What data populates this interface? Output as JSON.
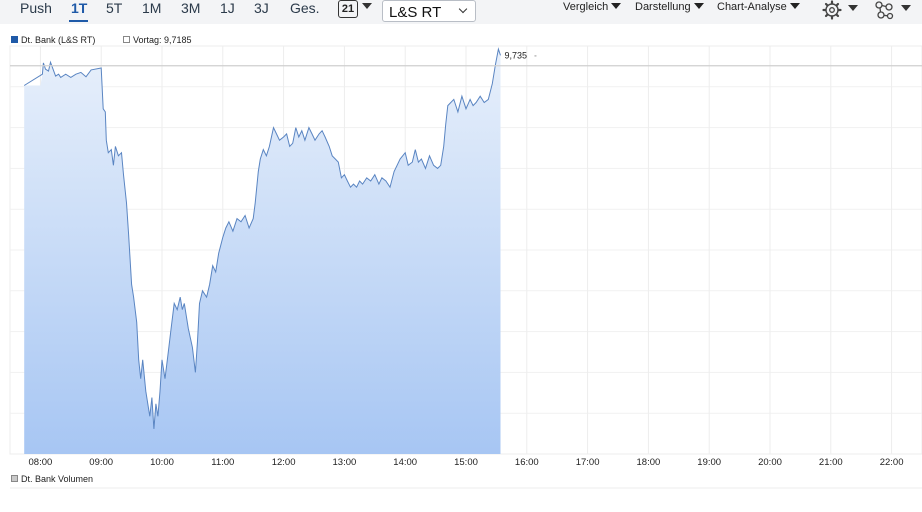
{
  "toolbar": {
    "range_tabs": [
      "Push",
      "1T",
      "5T",
      "1M",
      "3M",
      "1J",
      "3J",
      "Ges."
    ],
    "active_tab": "1T",
    "calendar_label": "21",
    "exchange": "L&S RT",
    "menus": [
      "Vergleich",
      "Darstellung",
      "Chart-Analyse"
    ],
    "icons": [
      "settings-gear-icon",
      "indicators-network-icon"
    ]
  },
  "legend": {
    "series_label": "Dt. Bank (L&S RT)",
    "prev_close_label": "Vortag: 9,7185",
    "volume_label": "Dt. Bank Volumen"
  },
  "colors": {
    "line": "#5a85c2",
    "fill_top": "#e8f0fb",
    "fill_bottom": "#a7c6f3",
    "active": "#1f5aa8",
    "swatch": "#1f5aa8"
  },
  "chart_data": {
    "type": "area",
    "title": "",
    "xlabel": "",
    "ylabel": "",
    "x_ticks": [
      "08:00",
      "09:00",
      "10:00",
      "11:00",
      "12:00",
      "13:00",
      "14:00",
      "15:00",
      "16:00",
      "17:00",
      "18:00",
      "19:00",
      "20:00",
      "21:00",
      "22:00"
    ],
    "x_range": [
      "07:30",
      "22:30"
    ],
    "ylim": [
      9.1,
      9.75
    ],
    "previous_close": 9.7185,
    "last_value_label": "9,735",
    "grid": true,
    "series": [
      {
        "name": "Dt. Bank (L&S RT)",
        "points": [
          [
            "07:30",
            9.687
          ],
          [
            "08:00",
            9.687
          ],
          [
            "08:02",
            9.705
          ],
          [
            "08:03",
            9.723
          ],
          [
            "08:05",
            9.713
          ],
          [
            "08:08",
            9.71
          ],
          [
            "08:10",
            9.724
          ],
          [
            "08:15",
            9.702
          ],
          [
            "08:18",
            9.705
          ],
          [
            "08:20",
            9.7
          ],
          [
            "08:25",
            9.705
          ],
          [
            "08:30",
            9.7
          ],
          [
            "08:35",
            9.705
          ],
          [
            "08:40",
            9.708
          ],
          [
            "08:45",
            9.701
          ],
          [
            "08:50",
            9.712
          ],
          [
            "09:00",
            9.715
          ],
          [
            "09:02",
            9.65
          ],
          [
            "09:04",
            9.645
          ],
          [
            "09:05",
            9.6
          ],
          [
            "09:07",
            9.58
          ],
          [
            "09:10",
            9.585
          ],
          [
            "09:12",
            9.56
          ],
          [
            "09:14",
            9.59
          ],
          [
            "09:17",
            9.575
          ],
          [
            "09:20",
            9.58
          ],
          [
            "09:22",
            9.545
          ],
          [
            "09:25",
            9.5
          ],
          [
            "09:27",
            9.45
          ],
          [
            "09:30",
            9.37
          ],
          [
            "09:32",
            9.35
          ],
          [
            "09:35",
            9.31
          ],
          [
            "09:37",
            9.25
          ],
          [
            "09:39",
            9.22
          ],
          [
            "09:41",
            9.25
          ],
          [
            "09:44",
            9.2
          ],
          [
            "09:46",
            9.18
          ],
          [
            "09:48",
            9.16
          ],
          [
            "09:50",
            9.19
          ],
          [
            "09:52",
            9.14
          ],
          [
            "09:54",
            9.18
          ],
          [
            "09:56",
            9.16
          ],
          [
            "09:58",
            9.2
          ],
          [
            "10:00",
            9.25
          ],
          [
            "10:03",
            9.22
          ],
          [
            "10:06",
            9.26
          ],
          [
            "10:09",
            9.3
          ],
          [
            "10:12",
            9.34
          ],
          [
            "10:15",
            9.33
          ],
          [
            "10:18",
            9.35
          ],
          [
            "10:20",
            9.33
          ],
          [
            "10:22",
            9.34
          ],
          [
            "10:24",
            9.32
          ],
          [
            "10:26",
            9.3
          ],
          [
            "10:30",
            9.27
          ],
          [
            "10:33",
            9.23
          ],
          [
            "10:35",
            9.28
          ],
          [
            "10:37",
            9.34
          ],
          [
            "10:40",
            9.36
          ],
          [
            "10:44",
            9.35
          ],
          [
            "10:47",
            9.37
          ],
          [
            "10:50",
            9.4
          ],
          [
            "10:53",
            9.39
          ],
          [
            "10:56",
            9.42
          ],
          [
            "11:00",
            9.445
          ],
          [
            "11:03",
            9.46
          ],
          [
            "11:06",
            9.47
          ],
          [
            "11:10",
            9.455
          ],
          [
            "11:14",
            9.475
          ],
          [
            "11:18",
            9.47
          ],
          [
            "11:22",
            9.48
          ],
          [
            "11:26",
            9.46
          ],
          [
            "11:30",
            9.475
          ],
          [
            "11:32",
            9.5
          ],
          [
            "11:35",
            9.55
          ],
          [
            "11:37",
            9.57
          ],
          [
            "11:40",
            9.585
          ],
          [
            "11:43",
            9.575
          ],
          [
            "11:46",
            9.59
          ],
          [
            "11:50",
            9.62
          ],
          [
            "11:53",
            9.61
          ],
          [
            "11:56",
            9.6
          ],
          [
            "12:00",
            9.605
          ],
          [
            "12:03",
            9.61
          ],
          [
            "12:06",
            9.59
          ],
          [
            "12:09",
            9.595
          ],
          [
            "12:12",
            9.62
          ],
          [
            "12:15",
            9.605
          ],
          [
            "12:18",
            9.615
          ],
          [
            "12:21",
            9.6
          ],
          [
            "12:25",
            9.62
          ],
          [
            "12:28",
            9.61
          ],
          [
            "12:31",
            9.6
          ],
          [
            "12:35",
            9.61
          ],
          [
            "12:38",
            9.615
          ],
          [
            "12:41",
            9.605
          ],
          [
            "12:45",
            9.59
          ],
          [
            "12:48",
            9.575
          ],
          [
            "12:51",
            9.57
          ],
          [
            "12:54",
            9.565
          ],
          [
            "12:57",
            9.54
          ],
          [
            "13:00",
            9.545
          ],
          [
            "13:03",
            9.535
          ],
          [
            "13:06",
            9.525
          ],
          [
            "13:09",
            9.53
          ],
          [
            "13:12",
            9.525
          ],
          [
            "13:15",
            9.535
          ],
          [
            "13:18",
            9.53
          ],
          [
            "13:22",
            9.54
          ],
          [
            "13:26",
            9.535
          ],
          [
            "13:30",
            9.545
          ],
          [
            "13:34",
            9.53
          ],
          [
            "13:37",
            9.54
          ],
          [
            "13:41",
            9.535
          ],
          [
            "13:45",
            9.525
          ],
          [
            "13:49",
            9.55
          ],
          [
            "13:52",
            9.56
          ],
          [
            "13:55",
            9.57
          ],
          [
            "14:00",
            9.58
          ],
          [
            "14:03",
            9.56
          ],
          [
            "14:07",
            9.565
          ],
          [
            "14:10",
            9.585
          ],
          [
            "14:13",
            9.565
          ],
          [
            "14:16",
            9.57
          ],
          [
            "14:20",
            9.555
          ],
          [
            "14:24",
            9.575
          ],
          [
            "14:28",
            9.56
          ],
          [
            "14:32",
            9.555
          ],
          [
            "14:35",
            9.56
          ],
          [
            "14:38",
            9.59
          ],
          [
            "14:40",
            9.625
          ],
          [
            "14:42",
            9.655
          ],
          [
            "14:45",
            9.66
          ],
          [
            "14:48",
            9.665
          ],
          [
            "14:52",
            9.645
          ],
          [
            "14:56",
            9.67
          ],
          [
            "15:00",
            9.65
          ],
          [
            "15:04",
            9.665
          ],
          [
            "15:07",
            9.655
          ],
          [
            "15:10",
            9.66
          ],
          [
            "15:14",
            9.67
          ],
          [
            "15:18",
            9.66
          ],
          [
            "15:22",
            9.665
          ],
          [
            "15:26",
            9.69
          ],
          [
            "15:29",
            9.72
          ],
          [
            "15:32",
            9.745
          ],
          [
            "15:34",
            9.735
          ]
        ]
      }
    ]
  }
}
